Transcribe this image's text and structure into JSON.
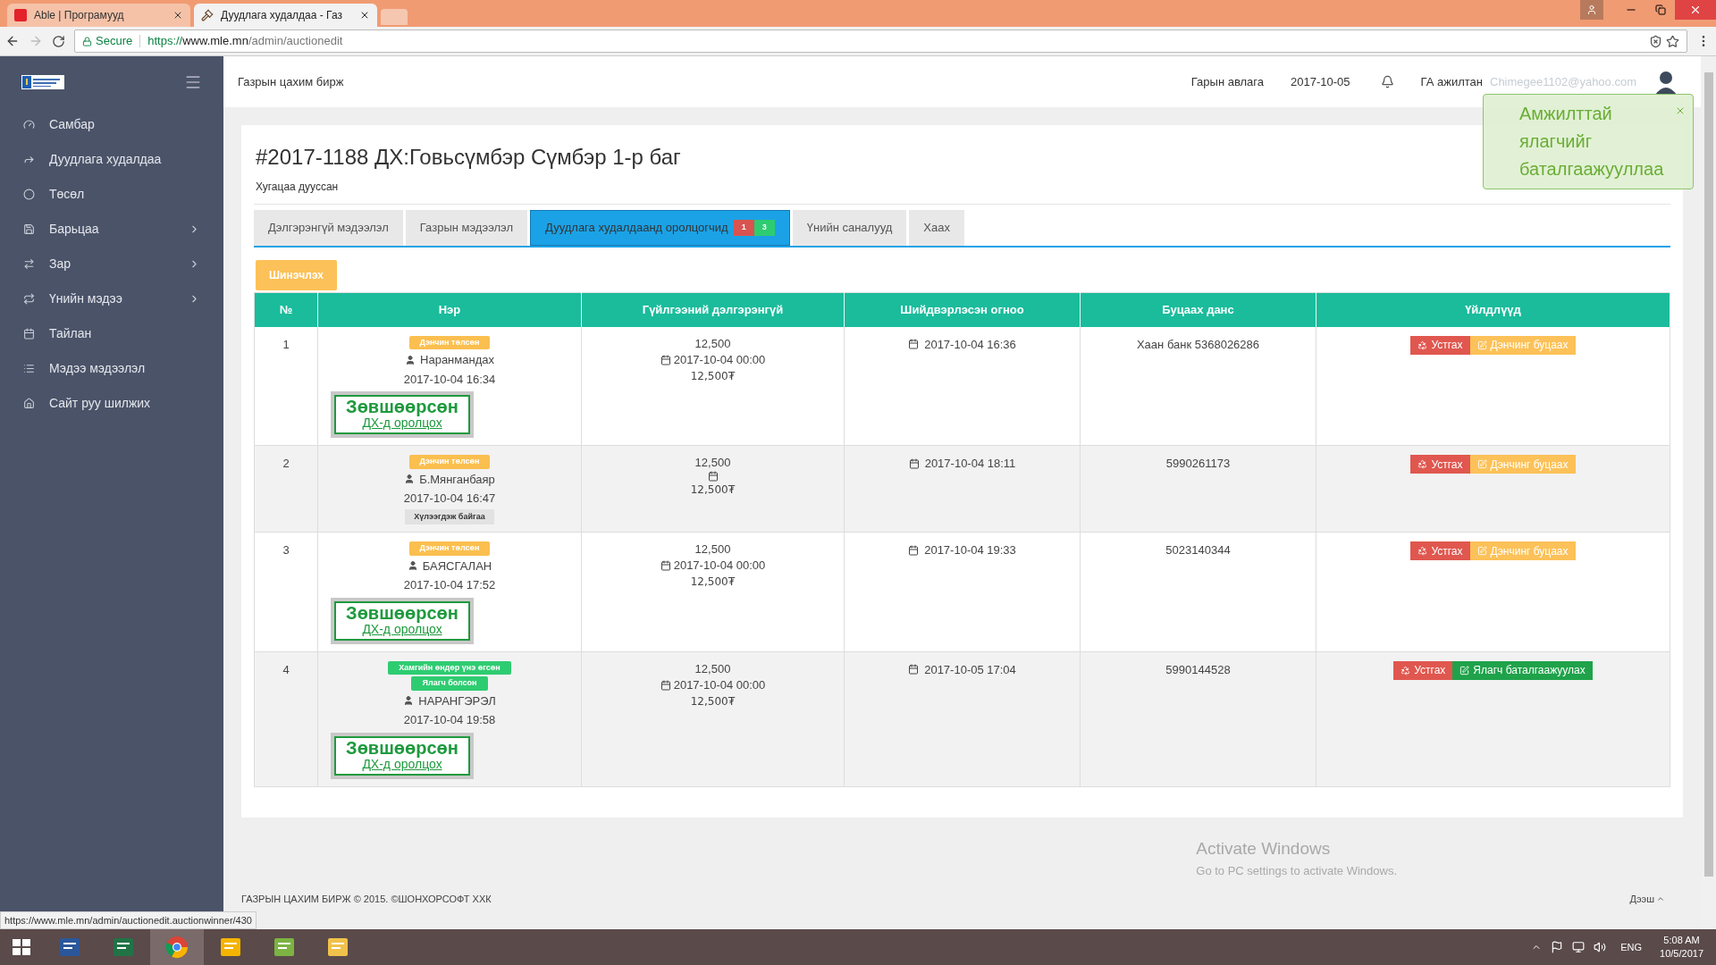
{
  "browser": {
    "tabs": [
      {
        "title": "Able | Програмууд",
        "selected": false
      },
      {
        "title": "Дуудлага худалдаа - Газ",
        "selected": true
      }
    ],
    "secure_label": "Secure",
    "url_scheme": "https://",
    "url_host": "www.mle.mn",
    "url_path": "/admin/auctionedit"
  },
  "sidebar": {
    "items": [
      {
        "label": "Самбар",
        "has_submenu": false
      },
      {
        "label": "Дуудлага худалдаа",
        "has_submenu": false
      },
      {
        "label": "Төсөл",
        "has_submenu": false
      },
      {
        "label": "Барьцаа",
        "has_submenu": true
      },
      {
        "label": "Зар",
        "has_submenu": true
      },
      {
        "label": "Үнийн мэдээ",
        "has_submenu": true
      },
      {
        "label": "Тайлан",
        "has_submenu": false
      },
      {
        "label": "Мэдээ мэдээлэл",
        "has_submenu": false
      },
      {
        "label": "Сайт руу шилжих",
        "has_submenu": false
      }
    ]
  },
  "header": {
    "brand": "Газрын цахим бирж",
    "guide": "Гарын авлага",
    "date": "2017-10-05",
    "user": "ГА ажилтан",
    "email": "Chimegee1102@yahoo.com"
  },
  "toast": {
    "message": "Амжилттай ялагчийг баталгаажууллаа"
  },
  "page": {
    "title": "#2017-1188 ДХ:Говьсүмбэр Сүмбэр 1-р баг",
    "status": "Хугацаа дууссан",
    "tabs": [
      {
        "label": "Дэлгэрэнгүй мэдээлэл",
        "selected": false
      },
      {
        "label": "Газрын мэдээлэл",
        "selected": false
      },
      {
        "label": "Дуудлага худалдаанд оролцогчид",
        "selected": true,
        "badges": [
          {
            "text": "1",
            "color": "#d9534f"
          },
          {
            "text": "3",
            "color": "#2ecc71"
          }
        ]
      },
      {
        "label": "Үнийн саналууд",
        "selected": false
      },
      {
        "label": "Хаах",
        "selected": false
      }
    ],
    "refresh_button": "Шинэчлэх"
  },
  "table": {
    "columns": [
      "№",
      "Нэр",
      "Гүйлгээний дэлгэрэнгүй",
      "Шийдвэрлэсэн огноо",
      "Буцаах данс",
      "Үйлдлүүд"
    ],
    "rows": [
      {
        "number": "1",
        "badges": [
          {
            "text": "Дэнчин төлсөн",
            "color": "#fbbf4f"
          }
        ],
        "name": "Наранмандах",
        "time": "2017-10-04 16:34",
        "approval": {
          "title": "Зөвшөөрсөн",
          "link": "ДХ-д оролцох"
        },
        "amount": "12,500",
        "date": "2017-10-04 00:00",
        "paid": "12,500₮",
        "decided": "2017-10-04 16:36",
        "account": "Хаан банк 5368026286",
        "actions": [
          {
            "label": "Устгах",
            "kind": "delete"
          },
          {
            "label": "Дэнчинг буцаах",
            "kind": "refund"
          }
        ]
      },
      {
        "number": "2",
        "badges": [
          {
            "text": "Дэнчин төлсөн",
            "color": "#fbbf4f"
          }
        ],
        "name": "Б.Мянганбаяр",
        "time": "2017-10-04 16:47",
        "waiting": "Хүлээгдэж байгаа",
        "amount": "12,500",
        "paid": "12,500₮",
        "decided": "2017-10-04 18:11",
        "account": "5990261173",
        "actions": [
          {
            "label": "Устгах",
            "kind": "delete"
          },
          {
            "label": "Дэнчинг буцаах",
            "kind": "refund"
          }
        ]
      },
      {
        "number": "3",
        "badges": [
          {
            "text": "Дэнчин төлсөн",
            "color": "#fbbf4f"
          }
        ],
        "name": "БАЯСГАЛАН",
        "time": "2017-10-04 17:52",
        "approval": {
          "title": "Зөвшөөрсөн",
          "link": "ДХ-д оролцох"
        },
        "amount": "12,500",
        "date": "2017-10-04 00:00",
        "paid": "12,500₮",
        "decided": "2017-10-04 19:33",
        "account": "5023140344",
        "actions": [
          {
            "label": "Устгах",
            "kind": "delete"
          },
          {
            "label": "Дэнчинг буцаах",
            "kind": "refund"
          }
        ]
      },
      {
        "number": "4",
        "badges": [
          {
            "text": "Хамгийн өндөр үнэ өгсөн",
            "color": "#2ecc71"
          },
          {
            "text": "Ялагч болсон",
            "color": "#2ecc71"
          }
        ],
        "name": "НАРАНГЭРЭЛ",
        "time": "2017-10-04 19:58",
        "approval": {
          "title": "Зөвшөөрсөн",
          "link": "ДХ-д оролцох"
        },
        "amount": "12,500",
        "date": "2017-10-04 00:00",
        "paid": "12,500₮",
        "decided": "2017-10-05 17:04",
        "account": "5990144528",
        "actions": [
          {
            "label": "Устгах",
            "kind": "delete"
          },
          {
            "label": "Ялагч баталгаажуулах",
            "kind": "confirm"
          }
        ]
      }
    ]
  },
  "footer": {
    "copyright": "ГАЗРЫН ЦАХИМ БИРЖ © 2015. ©ШОНХОРСОФТ ХХК",
    "top_link": "Дээш"
  },
  "activation": {
    "title": "Activate Windows",
    "hint": "Go to PC settings to activate Windows."
  },
  "status_url": "https://www.mle.mn/admin/auctionedit.auctionwinner/430",
  "taskbar": {
    "language": "ENG",
    "time": "5:08 AM",
    "date": "10/5/2017"
  }
}
